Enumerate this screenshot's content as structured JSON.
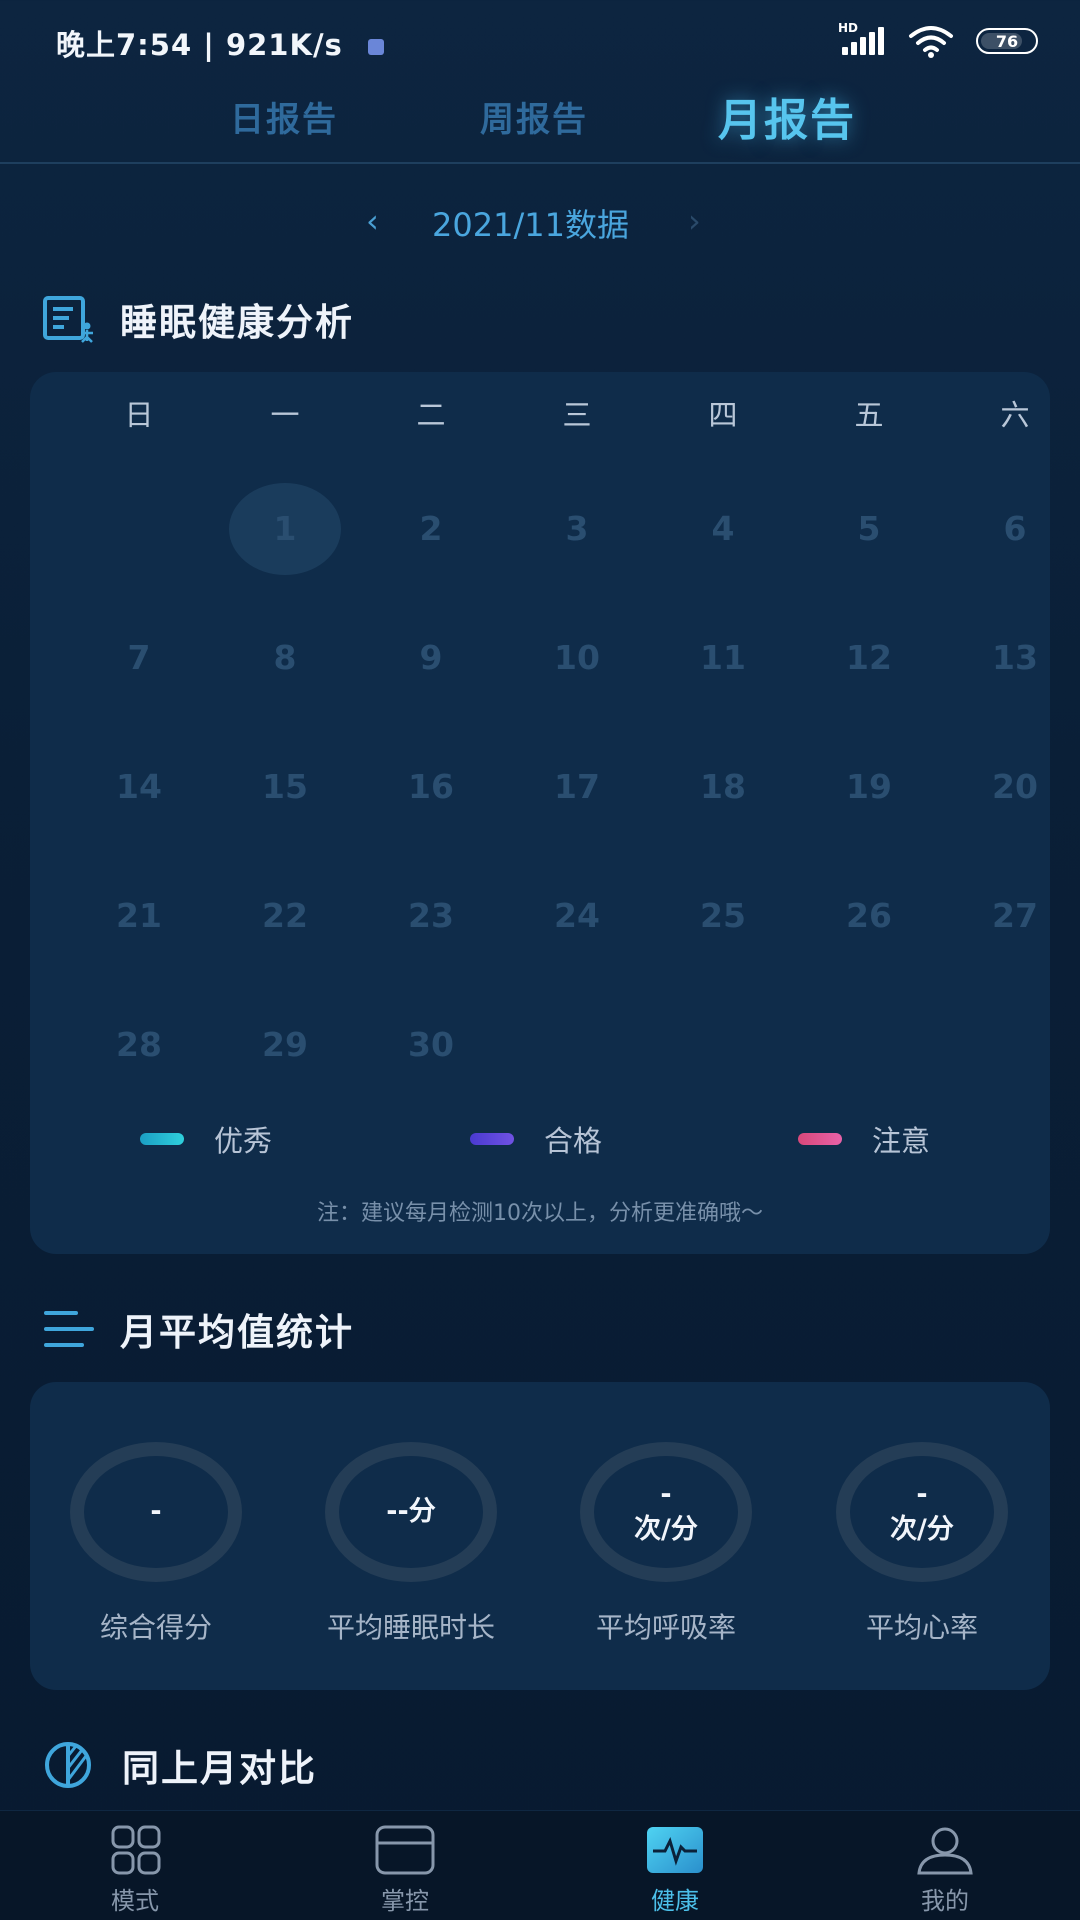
{
  "status_bar": {
    "time": "晚上7:54",
    "speed": "921K/s",
    "network": "HD",
    "battery": "76"
  },
  "tabs": [
    {
      "label": "日报告",
      "active": false
    },
    {
      "label": "周报告",
      "active": false
    },
    {
      "label": "月报告",
      "active": true
    }
  ],
  "month_nav": {
    "prev": "‹",
    "label": "2021/11数据",
    "next": "›"
  },
  "sleep_section": {
    "title": "睡眠健康分析",
    "weekdays": [
      "日",
      "一",
      "二",
      "三",
      "四",
      "五",
      "六"
    ],
    "days": [
      "1",
      "2",
      "3",
      "4",
      "5",
      "6",
      "7",
      "8",
      "9",
      "10",
      "11",
      "12",
      "13",
      "14",
      "15",
      "16",
      "17",
      "18",
      "19",
      "20",
      "21",
      "22",
      "23",
      "24",
      "25",
      "26",
      "27",
      "28",
      "29",
      "30"
    ],
    "first_day_offset": 1,
    "today": "1",
    "legend": [
      {
        "label": "优秀",
        "color": "#21b4d0"
      },
      {
        "label": "合格",
        "color": "#5b44d8"
      },
      {
        "label": "注意",
        "color": "#e0518f"
      }
    ],
    "note": "注：建议每月检测10次以上，分析更准确哦～"
  },
  "monthly_section": {
    "title": "月平均值统计",
    "stats": [
      {
        "label": "综合得分",
        "value": "-",
        "unit": ""
      },
      {
        "label": "平均睡眠时长",
        "value": "--分",
        "unit": ""
      },
      {
        "label": "平均呼吸率",
        "value": "-",
        "unit": "次/分"
      },
      {
        "label": "平均心率",
        "value": "-",
        "unit": "次/分"
      }
    ]
  },
  "compare_section": {
    "title": "同上月对比"
  },
  "bottom_nav": [
    {
      "label": "模式",
      "icon": "grid-icon",
      "active": false
    },
    {
      "label": "掌控",
      "icon": "panel-icon",
      "active": false
    },
    {
      "label": "健康",
      "icon": "heartbeat-icon",
      "active": true
    },
    {
      "label": "我的",
      "icon": "user-icon",
      "active": false
    }
  ],
  "colors": {
    "accent": "#4cc0ea",
    "background": "#0b2139",
    "card": "#0f2c4a"
  }
}
